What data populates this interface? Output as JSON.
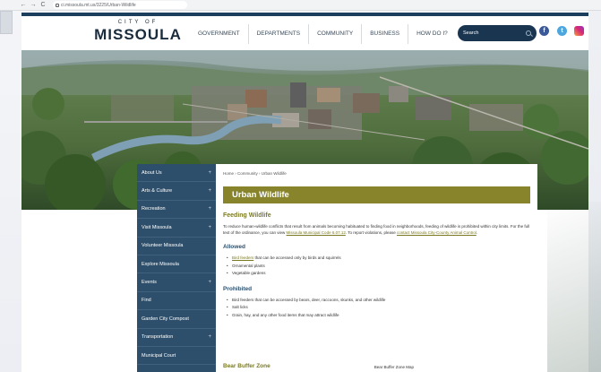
{
  "browser": {
    "url": "ci.missoula.mt.us/3225/Urban-Wildlife",
    "back": "←",
    "forward": "→",
    "reload": "C"
  },
  "header": {
    "logo_small": "CITY OF",
    "logo_big": "MISSOULA",
    "nav": [
      "GOVERNMENT",
      "DEPARTMENTS",
      "COMMUNITY",
      "BUSINESS",
      "HOW DO I?"
    ],
    "search_placeholder": "Search",
    "social": [
      "f",
      "t",
      ""
    ]
  },
  "sidebar": {
    "items": [
      {
        "label": "About Us",
        "plus": "+"
      },
      {
        "label": "Arts & Culture",
        "plus": "+"
      },
      {
        "label": "Recreation",
        "plus": "+"
      },
      {
        "label": "Visit Missoula",
        "plus": "+"
      },
      {
        "label": "Volunteer Missoula",
        "plus": ""
      },
      {
        "label": "Explore Missoula",
        "plus": ""
      },
      {
        "label": "Events",
        "plus": "+"
      },
      {
        "label": "Find",
        "plus": ""
      },
      {
        "label": "Garden City Compost",
        "plus": ""
      },
      {
        "label": "Transportation",
        "plus": "+"
      },
      {
        "label": "Municipal Court",
        "plus": ""
      }
    ]
  },
  "content": {
    "breadcrumb": "Home › Community › Urban Wildlife",
    "title": "Urban Wildlife",
    "feeding": {
      "heading": "Feeding Wildlife",
      "text_1": "To reduce human-wildlife conflicts that result from animals becoming habituated to finding food in neighborhoods, feeding of wildlife is prohibited within city limits. For the full text of the ordinance, you can view ",
      "link_1": "Missoula Municipal Code 6.07.12",
      "text_2": ". To report violations, please ",
      "link_2": "contact Missoula City-County Animal Control",
      "text_3": "."
    },
    "allowed": {
      "heading": "Allowed",
      "item_1_link": "Bird feeders",
      "item_1_text": " that can be accessed only by birds and squirrels",
      "item_2": "Ornamental plants",
      "item_3": "Vegetable gardens"
    },
    "prohibited": {
      "heading": "Prohibited",
      "items": [
        "Bird feeders that can be accessed by bears, deer, raccoons, skunks, and other wildlife",
        "Salt licks",
        "Grain, hay, and any other food items that may attract wildlife"
      ]
    },
    "bear_zone": {
      "heading": "Bear Buffer Zone",
      "map_label": "Bear Buffer Zone Map"
    }
  },
  "colors": {
    "nav_dark": "#1a3550",
    "sidebar": "#2e4f6b",
    "title_bar": "#87842b",
    "accent_olive": "#7a7a22"
  }
}
